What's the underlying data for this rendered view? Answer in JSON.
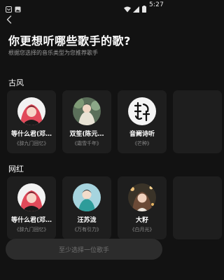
{
  "status_bar": {
    "time": "5:27",
    "icons": [
      "notification-icon",
      "image-icon",
      "wifi-icon",
      "signal-icon",
      "battery-icon"
    ]
  },
  "header": {
    "back_icon": "back-arrow-icon",
    "title": "你更想听哪些歌手的歌?",
    "subtitle": "根据您选择的音乐类型为您推荐歌手"
  },
  "sections": [
    {
      "title": "古风",
      "singers": [
        {
          "name": "等什么君(邓…",
          "song": "《辞九门回忆》"
        },
        {
          "name": "双笙(陈元…",
          "song": "《霜雪千年》"
        },
        {
          "name": "音阙诗听",
          "song": "《芒种》"
        }
      ]
    },
    {
      "title": "网红",
      "singers": [
        {
          "name": "等什么君(邓…",
          "song": "《辞九门回忆》"
        },
        {
          "name": "汪苏泷",
          "song": "《万有引力》"
        },
        {
          "name": "大籽",
          "song": "《白月光》"
        }
      ]
    }
  ],
  "footer": {
    "button_label": "至少选择一位歌手"
  },
  "colors": {
    "background": "#121212",
    "card": "#1e1e1e",
    "button_disabled": "#2c2c2c"
  }
}
